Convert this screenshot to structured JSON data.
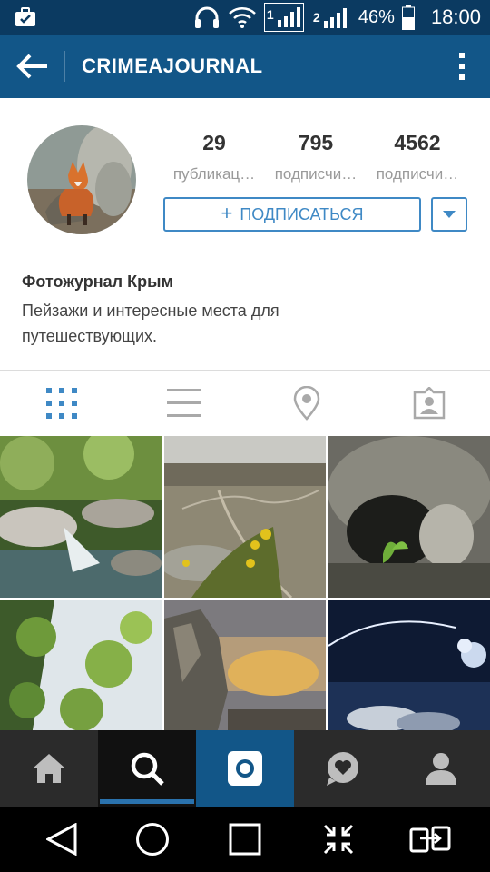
{
  "status_bar": {
    "battery_percent": "46%",
    "time": "18:00",
    "sim1_label": "1",
    "sim2_label": "2",
    "icons": [
      "briefcase-check-icon",
      "headphones-icon",
      "wifi-icon",
      "signal-sim1-icon",
      "signal-sim2-icon",
      "battery-icon"
    ]
  },
  "app_bar": {
    "title": "CRIMEAJOURNAL",
    "icons": [
      "back-arrow-icon",
      "more-vert-icon"
    ]
  },
  "profile": {
    "avatar_icon": "avatar-fox-photo",
    "stats": [
      {
        "count": "29",
        "label": "публикац…"
      },
      {
        "count": "795",
        "label": "подписчи…"
      },
      {
        "count": "4562",
        "label": "подписчи…"
      }
    ],
    "follow_button": {
      "icon": "+",
      "label": "ПОДПИСАТЬСЯ"
    },
    "dropdown_icon": "caret-down-icon",
    "bio_name": "Фотожурнал Крым",
    "bio_text": "Пейзажи и интересные места для путешествующих."
  },
  "view_tabs": [
    {
      "icon": "grid-icon",
      "active": true
    },
    {
      "icon": "list-icon",
      "active": false
    },
    {
      "icon": "location-pin-icon",
      "active": false
    },
    {
      "icon": "tagged-photos-icon",
      "active": false
    }
  ],
  "photos": [
    "forest-stream-photo",
    "valley-flowers-photo",
    "cave-photo",
    "tree-leaves-photo",
    "cliff-sunset-photo",
    "night-sky-photo"
  ],
  "bottom_nav": [
    {
      "icon": "home-icon"
    },
    {
      "icon": "search-icon",
      "active": true
    },
    {
      "icon": "camera-icon"
    },
    {
      "icon": "activity-heart-icon"
    },
    {
      "icon": "profile-icon"
    }
  ],
  "system_nav": [
    "back-triangle-icon",
    "home-circle-icon",
    "recents-square-icon",
    "collapse-icon",
    "switch-sim-icon"
  ],
  "colors": {
    "status_bar": "#0b3a61",
    "app_bar": "#125688",
    "accent": "#3f89c5",
    "bottom_nav": "#2b2b2b"
  }
}
